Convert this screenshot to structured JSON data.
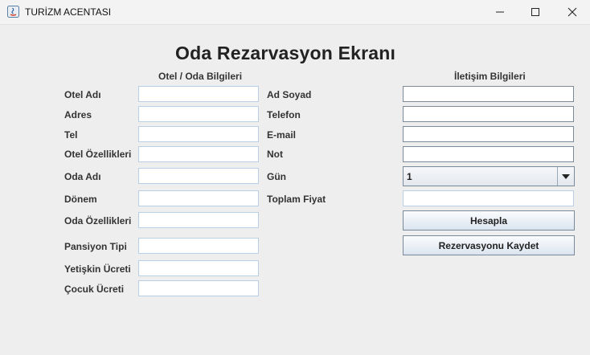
{
  "window": {
    "title": "TURİZM ACENTASI"
  },
  "heading": "Oda Rezarvasyon Ekranı",
  "sections": {
    "hotel": "Otel / Oda Bilgileri",
    "contact": "İletişim Bilgileri"
  },
  "hotel_fields": [
    {
      "label": "Otel Adı",
      "value": ""
    },
    {
      "label": "Adres",
      "value": ""
    },
    {
      "label": "Tel",
      "value": ""
    },
    {
      "label": "Otel Özellikleri",
      "value": ""
    },
    {
      "label": "Oda Adı",
      "value": ""
    },
    {
      "label": "Dönem",
      "value": ""
    },
    {
      "label": "Oda Özellikleri",
      "value": ""
    },
    {
      "label": "Pansiyon Tipi",
      "value": ""
    },
    {
      "label": "Yetişkin Ücreti",
      "value": ""
    },
    {
      "label": "Çocuk Ücreti",
      "value": ""
    }
  ],
  "contact_fields": [
    {
      "label": "Ad Soyad",
      "value": ""
    },
    {
      "label": "Telefon",
      "value": ""
    },
    {
      "label": "E-mail",
      "value": ""
    },
    {
      "label": "Not",
      "value": ""
    },
    {
      "label": "Gün",
      "value": "1"
    },
    {
      "label": "Toplam Fiyat",
      "value": ""
    }
  ],
  "buttons": {
    "calculate": "Hesapla",
    "save": "Rezervasyonu Kaydet"
  }
}
